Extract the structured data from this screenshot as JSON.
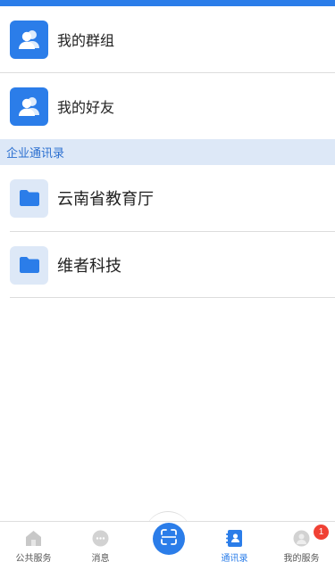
{
  "personal": [
    {
      "label": "我的群组",
      "icon": "group-icon"
    },
    {
      "label": "我的好友",
      "icon": "friends-icon"
    }
  ],
  "section_title": "企业通讯录",
  "org": [
    {
      "label": "云南省教育厅",
      "icon": "folder-icon"
    },
    {
      "label": "维者科技",
      "icon": "folder-icon"
    }
  ],
  "tabs": [
    {
      "label": "公共服务",
      "icon": "home-icon"
    },
    {
      "label": "消息",
      "icon": "message-icon"
    },
    {
      "label": "",
      "icon": "scan-icon"
    },
    {
      "label": "通讯录",
      "icon": "contacts-icon",
      "active": true
    },
    {
      "label": "我的服务",
      "icon": "profile-icon",
      "badge": "1"
    }
  ],
  "colors": {
    "accent": "#2b7de9",
    "section_bg": "#dde8f7",
    "badge": "#f04134"
  }
}
